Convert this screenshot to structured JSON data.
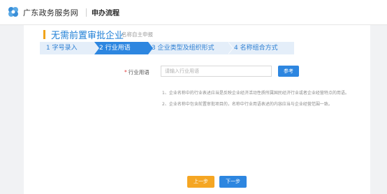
{
  "header": {
    "logo_icon": "gov-service-logo-icon",
    "site_name": "广东政务服务网",
    "page_label": "申办流程"
  },
  "main": {
    "title": "无需前置审批企业",
    "subtitle": "名称自主申报",
    "steps": [
      {
        "label": "1 字号录入",
        "active": false
      },
      {
        "label": "2 行业用语",
        "active": true
      },
      {
        "label": "3 企业类型及组织形式",
        "active": false
      },
      {
        "label": "4 名称组合方式",
        "active": false
      }
    ],
    "form": {
      "required_mark": "*",
      "industry_label": "行业用语",
      "industry_value": "",
      "industry_placeholder": "请输入行业用语",
      "reference_button": "参考"
    },
    "notes": [
      "1、企业名称中的行业表述应当是反映企业经济活动性质所属国民经济行业或者企业经营特点的用语。",
      "2、企业名称中包含前置审批项目的，名称中行业用语表述的内容应当与企业经营范围一致。"
    ],
    "nav": {
      "prev": "上一步",
      "next": "下一步"
    }
  },
  "colors": {
    "accent_blue": "#2d86e0",
    "title_blue": "#1f7fd6",
    "step_bg": "#e4eef9",
    "orange": "#f5a623",
    "background": "#f1f2f4"
  }
}
